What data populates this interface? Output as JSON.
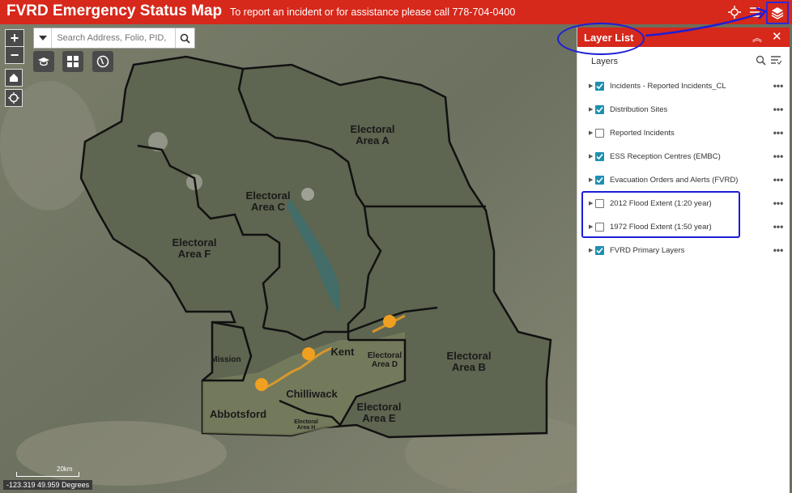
{
  "header": {
    "title": "FVRD Emergency Status Map",
    "banner": "To report an incident or for assistance please call 778-704-0400"
  },
  "search": {
    "placeholder": "Search Address, Folio, PID,"
  },
  "map": {
    "labels": {
      "area_a": "Electoral Area A",
      "area_b": "Electoral Area B",
      "area_c": "Electoral Area C",
      "area_d": "Electoral Area D",
      "area_e": "Electoral Area E",
      "area_f": "Electoral Area F",
      "area_h": "Electoral Area H",
      "kent": "Kent",
      "mission": "Mission",
      "chilliwack": "Chilliwack",
      "abbotsford": "Abbotsford"
    },
    "coords": "-123.319 49.959 Degrees",
    "scale": "20km"
  },
  "panel": {
    "title": "Layer List",
    "subtitle": "Layers",
    "layers": [
      {
        "name": "Incidents - Reported Incidents_CL",
        "checked": true
      },
      {
        "name": "Distribution Sites",
        "checked": true
      },
      {
        "name": "Reported Incidents",
        "checked": false
      },
      {
        "name": "ESS Reception Centres (EMBC)",
        "checked": true
      },
      {
        "name": "Evacuation Orders and Alerts (FVRD)",
        "checked": true
      },
      {
        "name": "2012 Flood Extent (1:20 year)",
        "checked": false
      },
      {
        "name": "1972 Flood Extent (1:50 year)",
        "checked": false
      },
      {
        "name": "FVRD Primary Layers",
        "checked": true
      }
    ]
  },
  "colors": {
    "header_red": "#d6281b",
    "checkbox_blue": "#1e8fb0",
    "annotation_blue": "#1d1dd6",
    "incident_orange": "#f0a020"
  }
}
